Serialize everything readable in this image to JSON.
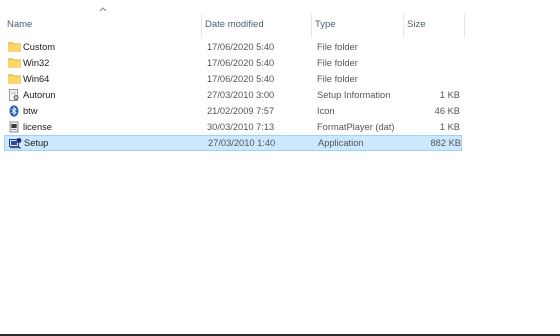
{
  "columns": {
    "name": "Name",
    "date_modified": "Date modified",
    "type": "Type",
    "size": "Size"
  },
  "sort": {
    "column": "name",
    "direction": "ascending"
  },
  "files": [
    {
      "name": "Custom",
      "date": "17/06/2020 5:40",
      "type": "File folder",
      "size": "",
      "icon": "folder-icon"
    },
    {
      "name": "Win32",
      "date": "17/06/2020 5:40",
      "type": "File folder",
      "size": "",
      "icon": "folder-icon"
    },
    {
      "name": "Win64",
      "date": "17/06/2020 5:40",
      "type": "File folder",
      "size": "",
      "icon": "folder-icon"
    },
    {
      "name": "Autorun",
      "date": "27/03/2010 3:00",
      "type": "Setup Information",
      "size": "1 KB",
      "icon": "setup-info-icon"
    },
    {
      "name": "btw",
      "date": "21/02/2009 7:57",
      "type": "Icon",
      "size": "46 KB",
      "icon": "bluetooth-icon"
    },
    {
      "name": "license",
      "date": "30/03/2010 7:13",
      "type": "FormatPlayer (dat)",
      "size": "1 KB",
      "icon": "dat-file-icon"
    },
    {
      "name": "Setup",
      "date": "27/03/2010 1:40",
      "type": "Application",
      "size": "882 KB",
      "icon": "setup-app-icon",
      "selected": true
    }
  ],
  "colors": {
    "selection_fill": "#cce8ff",
    "selection_border": "#99d1ff",
    "header_text": "#4c607a",
    "folder": "#f4c44e"
  }
}
